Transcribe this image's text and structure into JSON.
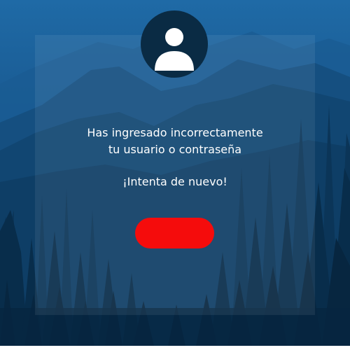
{
  "dialog": {
    "message_line1": "Has ingresado incorrectamente",
    "message_line2": "tu usuario o contraseña",
    "retry_text": "¡Intenta de nuevo!",
    "button_label": ""
  },
  "colors": {
    "accent_button": "#f50c0c",
    "avatar_bg": "#0a2b44",
    "text": "#ffffff",
    "background_top": "#1f6aa6",
    "background_bottom": "#052440"
  },
  "icons": {
    "avatar": "user-silhouette-icon",
    "background": "forest-mountains-background"
  }
}
